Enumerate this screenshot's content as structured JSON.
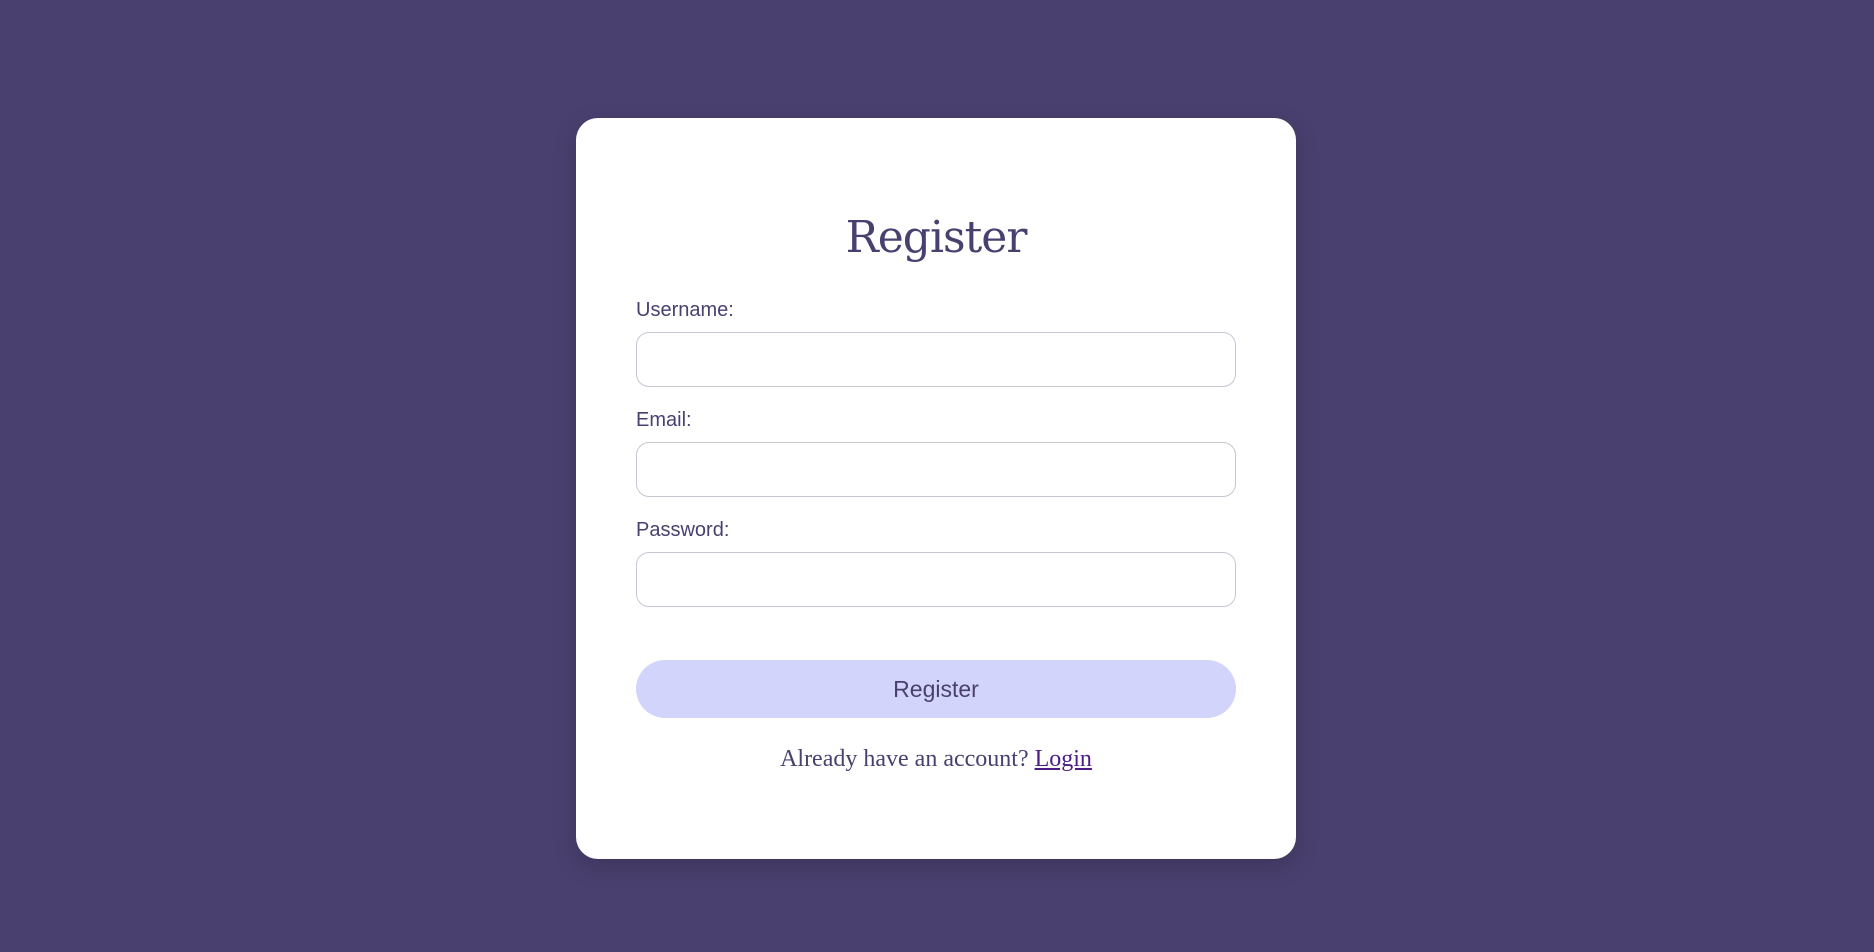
{
  "form": {
    "title": "Register",
    "fields": [
      {
        "label": "Username:",
        "value": "",
        "placeholder": ""
      },
      {
        "label": "Email:",
        "value": "",
        "placeholder": ""
      },
      {
        "label": "Password:",
        "value": "",
        "placeholder": ""
      }
    ],
    "submit_label": "Register",
    "footer_text": "Already have an account?",
    "login_link_label": "Login"
  },
  "colors": {
    "background": "#4a4070",
    "card": "#ffffff",
    "button": "#d2d4fb",
    "text": "#4a4070",
    "link": "#4b1b86"
  }
}
